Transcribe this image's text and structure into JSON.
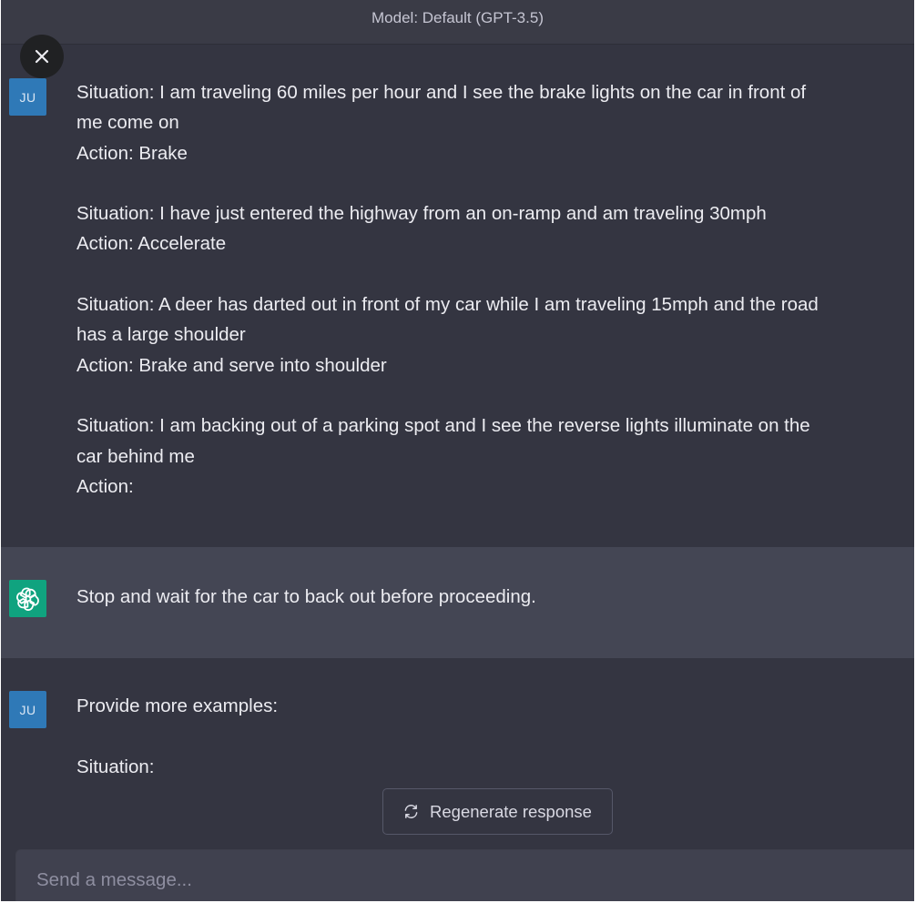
{
  "header": {
    "model_label": "Model: Default (GPT-3.5)"
  },
  "close_button": {
    "icon": "close-icon"
  },
  "messages": [
    {
      "role": "user",
      "avatar": "JU",
      "lines": [
        "Situation: I am traveling 60 miles per hour and I see the brake lights on the car in front of",
        "me come on",
        "Action: Brake",
        "",
        "Situation: I have just entered the highway from an on-ramp and am traveling 30mph",
        "Action: Accelerate",
        "",
        "Situation: A deer has darted out in front of my car while I am traveling 15mph and the road",
        "has a large shoulder",
        "Action: Brake and serve into shoulder",
        "",
        "Situation: I am backing out of a parking spot and I see the reverse lights illuminate on the",
        "car behind me",
        "Action:"
      ]
    },
    {
      "role": "assistant",
      "avatar_icon": "openai-logo-icon",
      "lines": [
        "Stop and wait for the car to back out before proceeding."
      ]
    },
    {
      "role": "user",
      "avatar": "JU",
      "lines": [
        "Provide more examples:",
        "",
        "Situation:"
      ]
    }
  ],
  "regenerate": {
    "label": "Regenerate response",
    "icon": "refresh-icon"
  },
  "composer": {
    "placeholder": "Send a message..."
  },
  "colors": {
    "background": "#343541",
    "assistant_background": "#444654",
    "user_avatar": "#2f79b7",
    "assistant_avatar": "#10a37f"
  }
}
